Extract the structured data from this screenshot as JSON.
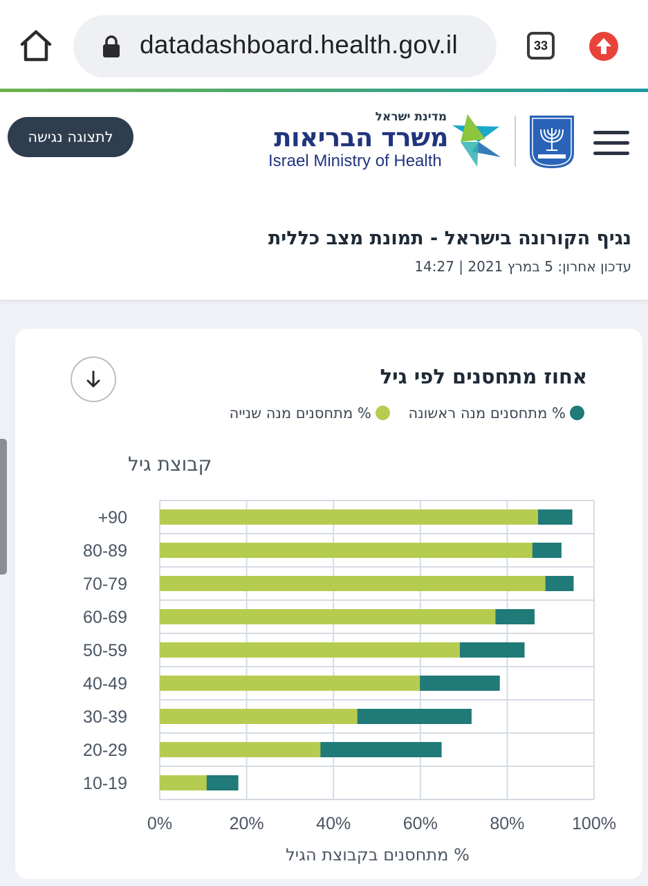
{
  "browser": {
    "url": "datadashboard.health.gov.il",
    "tab_count": "33",
    "icons": [
      "home-icon",
      "lock-icon",
      "tabs-icon",
      "update-arrow-icon"
    ]
  },
  "header": {
    "accessible_view_label": "לתצוגה נגישה",
    "ministry_small": "מדינת ישראל",
    "ministry_he": "משרד הבריאות",
    "ministry_en": "Israel Ministry of Health",
    "page_title": "נגיף הקורונה בישראל - תמונת מצב כללית",
    "last_update": "עדכון אחרון: 5 במרץ 2021 | 14:27"
  },
  "colors": {
    "first_dose": "#1f7a78",
    "second_dose": "#b5cc51",
    "accent_green": "#6cb34c",
    "accent_teal": "#1a9aa0"
  },
  "chart_data": {
    "type": "bar",
    "orientation": "horizontal",
    "stacked": "overlay",
    "title": "אחוז מתחסנים לפי גיל",
    "ylabel": "קבוצת גיל",
    "xlabel": "% מתחסנים בקבוצת הגיל",
    "categories": [
      "+90",
      "80-89",
      "70-79",
      "60-69",
      "50-59",
      "40-49",
      "30-39",
      "20-29",
      "10-19"
    ],
    "series": [
      {
        "name": "% מתחסנים מנה ראשונה",
        "color": "#1f7a78",
        "values": [
          95,
          92.5,
          95.3,
          86.3,
          84,
          78.3,
          71.8,
          64.9,
          18.1
        ]
      },
      {
        "name": "% מתחסנים מנה שנייה",
        "color": "#b5cc51",
        "values": [
          87.1,
          85.8,
          88.8,
          77.3,
          69.1,
          59.9,
          45.5,
          37,
          10.8
        ]
      }
    ],
    "xlim": [
      0,
      100
    ],
    "xticks": [
      "0%",
      "20%",
      "40%",
      "60%",
      "80%",
      "100%"
    ],
    "grid": true,
    "legend_position": "top-right"
  }
}
